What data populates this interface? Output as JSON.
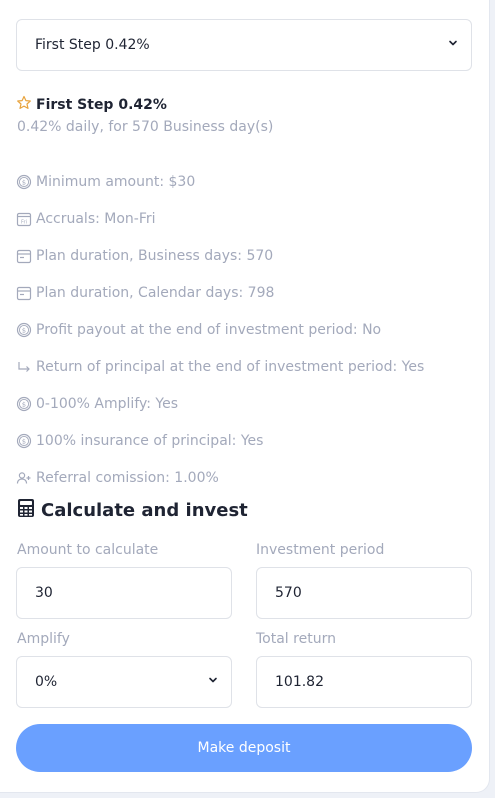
{
  "plan_select": {
    "value": "First Step 0.42%"
  },
  "plan": {
    "title": "First Step 0.42%",
    "subtitle": "0.42% daily, for 570 Business day(s)",
    "star_color": "#e8a33d"
  },
  "features": [
    {
      "icon": "dollar-circle-icon",
      "label": "Minimum amount: $30"
    },
    {
      "icon": "calendar-fri-icon",
      "label": "Accruals: Mon-Fri"
    },
    {
      "icon": "calendar-icon",
      "label": "Plan duration, Business days: 570"
    },
    {
      "icon": "calendar-icon",
      "label": "Plan duration, Calendar days: 798"
    },
    {
      "icon": "dollar-circle-icon",
      "label": "Profit payout at the end of investment period: No"
    },
    {
      "icon": "return-arrow-icon",
      "label": "Return of principal at the end of investment period: Yes"
    },
    {
      "icon": "dollar-circle-icon",
      "label": "0-100% Amplify: Yes"
    },
    {
      "icon": "dollar-circle-icon",
      "label": "100% insurance of principal: Yes"
    },
    {
      "icon": "user-plus-icon",
      "label": "Referral comission: 1.00%"
    }
  ],
  "calculator": {
    "title": "Calculate and invest",
    "amount_label": "Amount to calculate",
    "amount_value": "30",
    "period_label": "Investment period",
    "period_value": "570",
    "amplify_label": "Amplify",
    "amplify_value": "0%",
    "total_label": "Total return",
    "total_value": "101.82",
    "button_label": "Make deposit",
    "button_color": "#6aa0ff"
  }
}
